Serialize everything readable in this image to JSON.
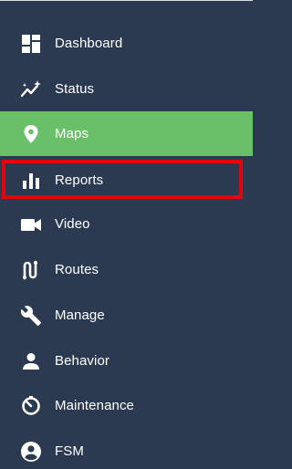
{
  "sidebar": {
    "accent_color": "#6abf69",
    "highlight_color": "#e3050c",
    "background_color": "#2b3a50",
    "items": [
      {
        "label": "Dashboard",
        "icon": "dashboard-icon"
      },
      {
        "label": "Status",
        "icon": "status-trend-icon"
      },
      {
        "label": "Maps",
        "icon": "map-pin-icon",
        "active": true
      },
      {
        "label": "Reports",
        "icon": "bar-chart-icon",
        "highlighted": true
      },
      {
        "label": "Video",
        "icon": "video-camera-icon"
      },
      {
        "label": "Routes",
        "icon": "route-icon"
      },
      {
        "label": "Manage",
        "icon": "wrench-icon"
      },
      {
        "label": "Behavior",
        "icon": "person-icon"
      },
      {
        "label": "Maintenance",
        "icon": "maintenance-timer-icon"
      },
      {
        "label": "FSM",
        "icon": "account-circle-icon"
      }
    ]
  }
}
